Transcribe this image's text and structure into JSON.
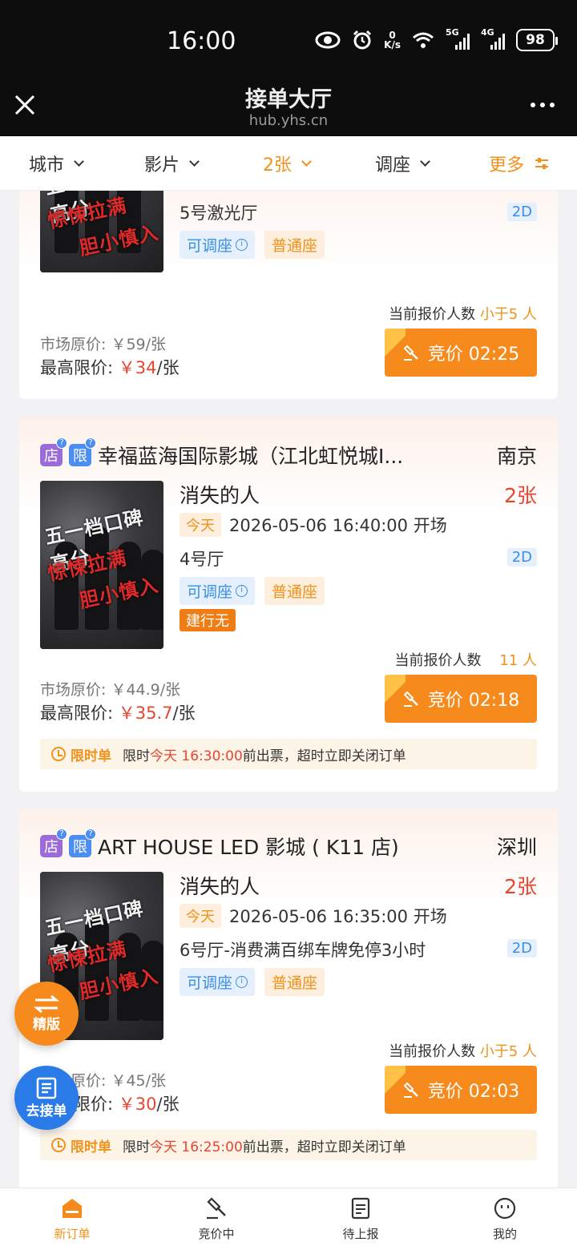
{
  "status_bar": {
    "time": "16:00",
    "net_speed_value": "0",
    "net_speed_unit": "K/s",
    "sig1_label": "5G",
    "sig2_label": "4G",
    "battery": "98"
  },
  "title_bar": {
    "title": "接单大厅",
    "subtitle": "hub.yhs.cn"
  },
  "filters": [
    {
      "label": "城市",
      "active": false
    },
    {
      "label": "影片",
      "active": false
    },
    {
      "label": "2张",
      "active": true
    },
    {
      "label": "调座",
      "active": false
    },
    {
      "label": "更多",
      "active": true
    }
  ],
  "cards": [
    {
      "hall": "5号激光厅",
      "format": "2D",
      "tag_adjustable": "可调座",
      "tag_seat": "普通座",
      "bidders_label": "当前报价人数",
      "bidders_value": "小于5 人",
      "market_price": "市场原价:  ￥59/张",
      "max_price_label": "最高限价:",
      "max_price_value": "￥34",
      "max_price_unit": "/张",
      "bid_label": "竞价 02:25"
    },
    {
      "tag_store": "店",
      "tag_limit": "限",
      "cinema": "幸福蓝海国际影城（江北虹悦城I...",
      "city": "南京",
      "movie": "消失的人",
      "count": "2张",
      "today": "今天",
      "showtime": "2026-05-06 16:40:00 开场",
      "hall": "4号厅",
      "format": "2D",
      "tag_adjustable": "可调座",
      "tag_seat": "普通座",
      "tag_bank": "建行无",
      "bidders_label": "当前报价人数",
      "bidders_value": "11 人",
      "market_price": "市场原价:  ￥44.9/张",
      "max_price_label": "最高限价:",
      "max_price_value": "￥35.7",
      "max_price_unit": "/张",
      "bid_label": "竞价 02:18",
      "limit_label": "限时单",
      "limit_prefix": "限时",
      "limit_time": "今天 16:30:00",
      "limit_suffix": "前出票，超时立即关闭订单"
    },
    {
      "tag_store": "店",
      "tag_limit": "限",
      "cinema": "ART HOUSE LED 影城 ( K11 店)",
      "city": "深圳",
      "movie": "消失的人",
      "count": "2张",
      "today": "今天",
      "showtime": "2026-05-06 16:35:00 开场",
      "hall": "6号厅-消费满百绑车牌免停3小时",
      "format": "2D",
      "tag_adjustable": "可调座",
      "tag_seat": "普通座",
      "bidders_label": "当前报价人数",
      "bidders_value": "小于5 人",
      "market_price": "市场原价:  ￥45/张",
      "max_price_label": "最高限价:",
      "max_price_value": "￥30",
      "max_price_unit": "/张",
      "bid_label": "竞价 02:03",
      "limit_label": "限时单",
      "limit_prefix": "限时",
      "limit_time": "今天 16:25:00",
      "limit_suffix": "前出票，超时立即关闭订单"
    }
  ],
  "poster_text": {
    "line1": "五一档口碑高分",
    "line2": "惊悚拉满",
    "line3": "胆小慎入"
  },
  "float_buttons": {
    "refine": "精版",
    "go_order": "去接单"
  },
  "bottom_nav": [
    {
      "label": "新订单",
      "icon": "home-icon",
      "active": true
    },
    {
      "label": "竞价中",
      "icon": "auction-icon",
      "active": false
    },
    {
      "label": "待上报",
      "icon": "document-icon",
      "active": false
    },
    {
      "label": "我的",
      "icon": "profile-icon",
      "active": false
    }
  ],
  "colors": {
    "accent_orange": "#f0921b",
    "price_red": "#e8452f",
    "blue": "#3a8ee6"
  }
}
